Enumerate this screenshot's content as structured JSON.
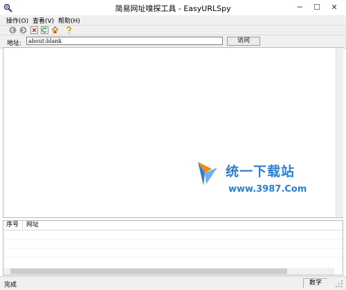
{
  "window": {
    "title": "简易网址嗅探工具 - EasyURLSpy",
    "controls": {
      "minimize": "─",
      "maximize": "☐",
      "close": "✕"
    }
  },
  "menu": [
    {
      "label": "操作(O)"
    },
    {
      "label": "查看(V)"
    },
    {
      "label": "帮助(H)"
    }
  ],
  "toolbar": {
    "buttons": [
      "back-icon",
      "forward-icon",
      "stop-icon",
      "refresh-icon",
      "home-icon",
      "help-icon"
    ]
  },
  "address": {
    "label": "地址:",
    "value": "about:blank",
    "visit_label": "访问"
  },
  "watermark": {
    "text": "统一下载站",
    "url": "www.3987.Com"
  },
  "list": {
    "columns": [
      "序号",
      "网址"
    ],
    "rows": []
  },
  "status": {
    "text": "完成",
    "numlock": "数字"
  },
  "colors": {
    "chrome": "#f0f0f0",
    "watermark_blue": "#2a7fd0",
    "watermark_orange": "#f08a1c"
  }
}
